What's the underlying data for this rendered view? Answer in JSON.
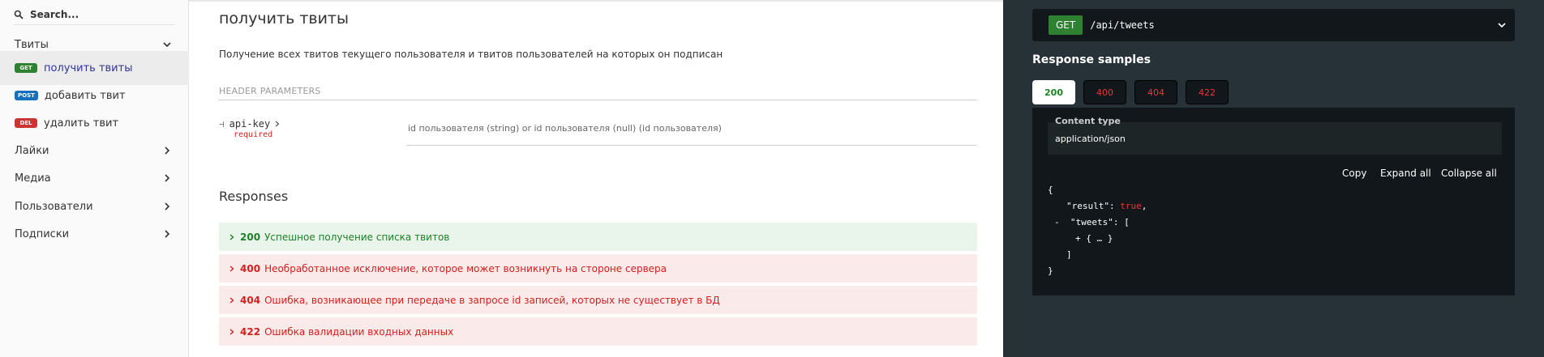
{
  "sidebar": {
    "search_placeholder": "Search...",
    "groups": [
      {
        "label": "Твиты",
        "expanded": true
      },
      {
        "label": "Лайки"
      },
      {
        "label": "Медиа"
      },
      {
        "label": "Пользователи"
      },
      {
        "label": "Подписки"
      }
    ],
    "ops": [
      {
        "badge": "GET",
        "label": "получить твиты",
        "active": true
      },
      {
        "badge": "POST",
        "label": "добавить твит"
      },
      {
        "badge": "DEL",
        "label": "удалить твит"
      }
    ]
  },
  "operation": {
    "title": "получить твиты",
    "description": "Получение всех твитов текущего пользователя и твитов пользователей на которых он подписан",
    "header_params_title": "HEADER PARAMETERS",
    "param": {
      "name": "api-key",
      "required": "required",
      "description": "id пользователя (string) or id пользователя (null) (id пользователя)"
    },
    "responses_title": "Responses",
    "responses": [
      {
        "code": "200",
        "text": "Успешное получение списка твитов"
      },
      {
        "code": "400",
        "text": "Необработанное исключение, которое может возникнуть на стороне сервера"
      },
      {
        "code": "404",
        "text": "Ошибка, возникающее при передаче в запросе id записей, которых не существует в БД"
      },
      {
        "code": "422",
        "text": "Ошибка валидации входных данных"
      }
    ]
  },
  "panel": {
    "method": "GET",
    "path": "/api/tweets",
    "samples_title": "Response samples",
    "tabs": [
      "200",
      "400",
      "404",
      "422"
    ],
    "content_type_label": "Content type",
    "content_type_value": "application/json",
    "actions": {
      "copy": "Copy",
      "expand": "Expand all",
      "collapse": "Collapse all"
    },
    "code": {
      "open": "{",
      "result_key": "\"result\": ",
      "result_val": "true",
      "comma": ",",
      "tweets_toggle": "-",
      "tweets_key": "\"tweets\": [",
      "item": "+ { … }",
      "close_arr": "]",
      "close": "}"
    }
  },
  "colors": {
    "get": "#2f8132",
    "post": "#186fbb",
    "del": "#cc3333",
    "success": "#1d8127",
    "error": "#d41f1c",
    "panel": "#263238",
    "panel_dark": "#11171a"
  }
}
